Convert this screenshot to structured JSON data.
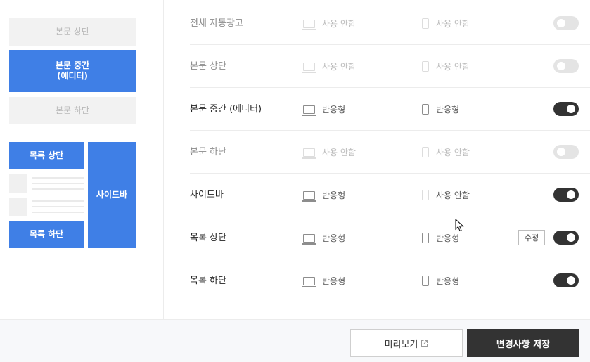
{
  "preview": {
    "body_top": "본문 상단",
    "body_middle": "본문 중간\n(에디터)",
    "body_bottom": "본문 하단",
    "list_top": "목록 상단",
    "list_bottom": "목록 하단",
    "sidebar": "사이드바"
  },
  "rows": [
    {
      "label": "전체 자동광고",
      "pc": "사용 안함",
      "mobile": "사용 안함",
      "enabled": false,
      "pc_icon": "desktop-icon",
      "mobile_icon": "mobile-icon"
    },
    {
      "label": "본문 상단",
      "pc": "사용 안함",
      "mobile": "사용 안함",
      "enabled": false,
      "pc_icon": "desktop-icon",
      "mobile_icon": "mobile-icon"
    },
    {
      "label": "본문 중간 (에디터)",
      "pc": "반응형",
      "mobile": "반응형",
      "enabled": true,
      "pc_icon": "desktop-icon",
      "mobile_icon": "mobile-icon"
    },
    {
      "label": "본문 하단",
      "pc": "사용 안함",
      "mobile": "사용 안함",
      "enabled": false,
      "pc_icon": "desktop-icon",
      "mobile_icon": "mobile-icon"
    },
    {
      "label": "사이드바",
      "pc": "반응형",
      "mobile": "사용 안함",
      "enabled": true,
      "pc_icon": "desktop-icon",
      "mobile_icon": "mobile-icon"
    },
    {
      "label": "목록 상단",
      "pc": "반응형",
      "mobile": "반응형",
      "enabled": true,
      "edit": "수정",
      "pc_icon": "desktop-icon",
      "mobile_icon": "mobile-icon"
    },
    {
      "label": "목록 하단",
      "pc": "반응형",
      "mobile": "반응형",
      "enabled": true,
      "pc_icon": "desktop-icon",
      "mobile_icon": "mobile-icon"
    }
  ],
  "footer": {
    "preview_label": "미리보기",
    "preview_icon": "external-link-icon",
    "save_label": "변경사항 저장"
  },
  "colors": {
    "accent": "#3f7fe6",
    "toggle_on": "#333333",
    "toggle_off": "#e4e4e4",
    "save_button": "#333333"
  }
}
